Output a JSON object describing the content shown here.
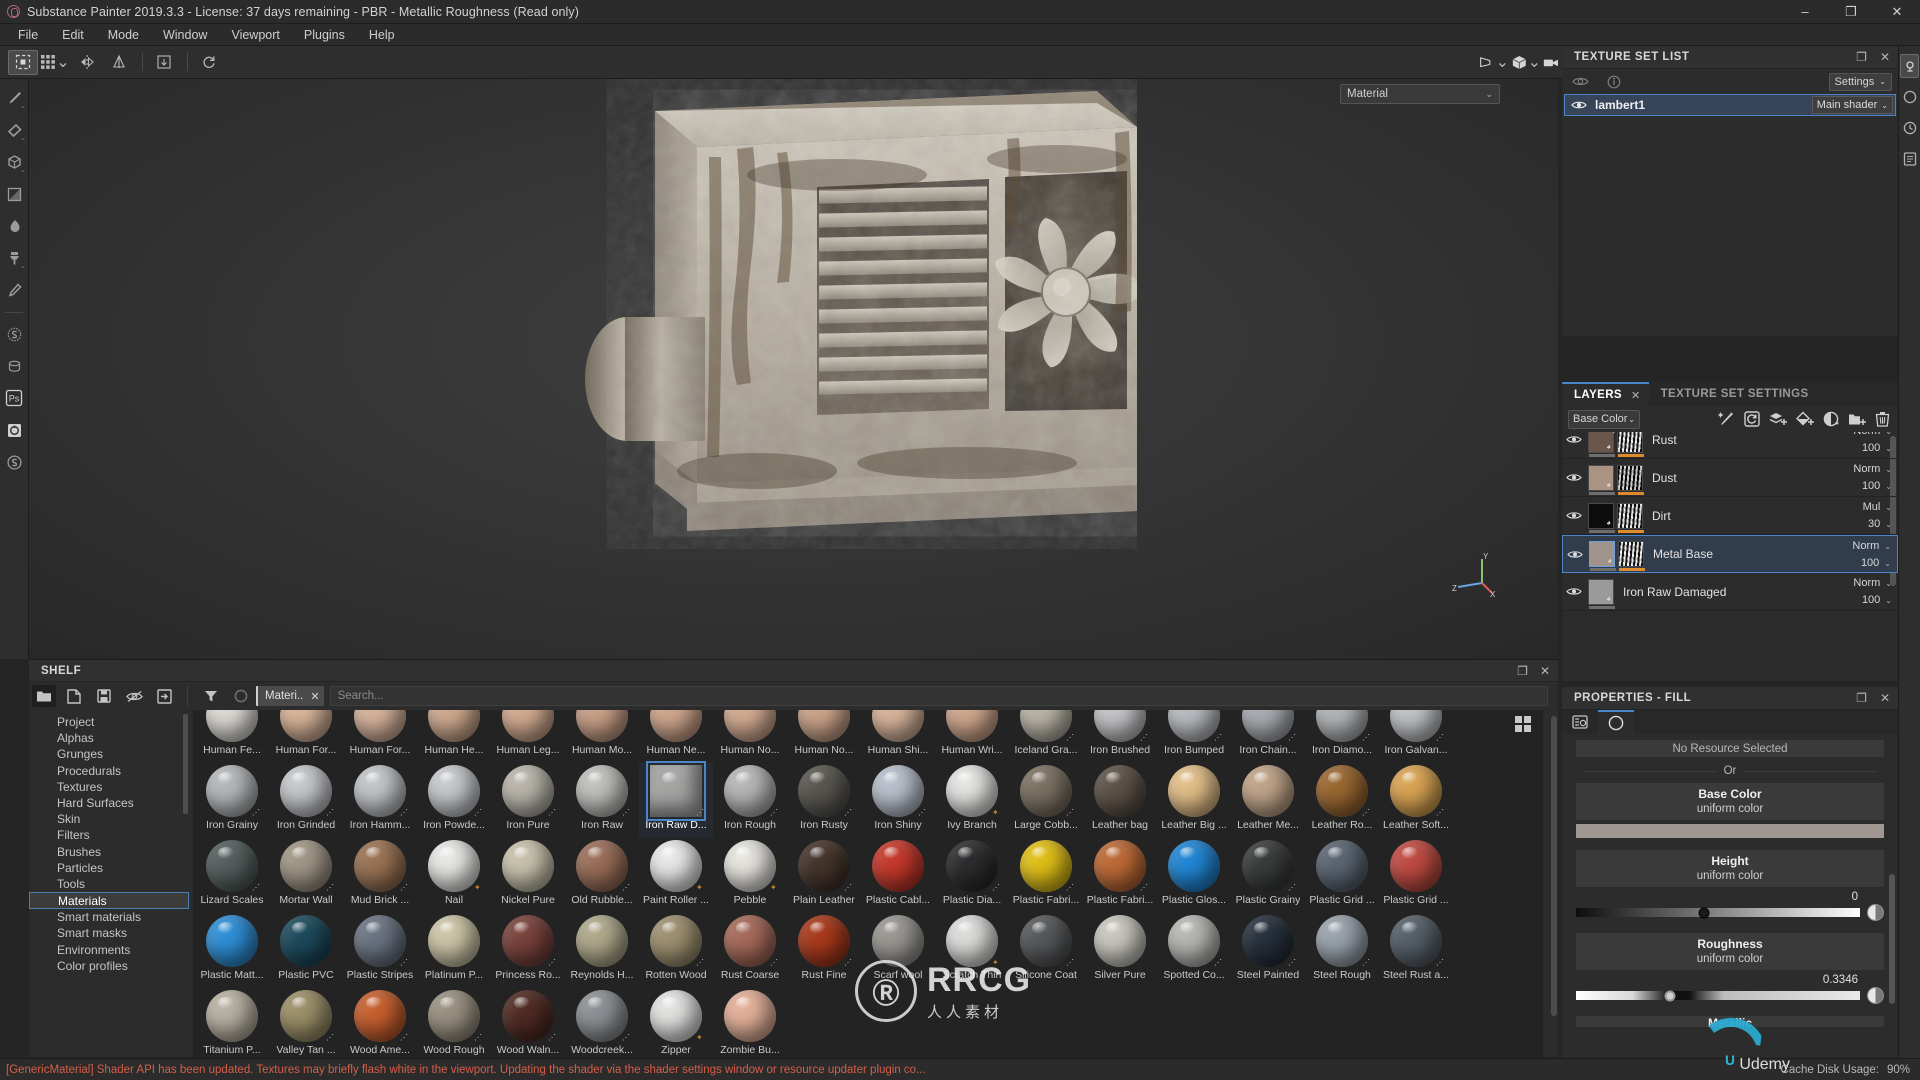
{
  "titlebar": {
    "title": "Substance Painter 2019.3.3 - License: 37 days remaining - PBR - Metallic Roughness (Read only)",
    "minimize": "–",
    "maximize": "❐",
    "close": "✕"
  },
  "menubar": {
    "items": [
      "File",
      "Edit",
      "Mode",
      "Window",
      "Viewport",
      "Plugins",
      "Help"
    ]
  },
  "viewport": {
    "material_selector": "Material",
    "axis": {
      "x": "X",
      "y": "Y",
      "z": "Z"
    }
  },
  "texture_set_list": {
    "title": "TEXTURE SET LIST",
    "settings_label": "Settings",
    "rows": [
      {
        "name": "lambert1",
        "shader": "Main shader"
      }
    ]
  },
  "layers_panel": {
    "tabs": [
      {
        "label": "LAYERS",
        "active": true
      },
      {
        "label": "TEXTURE SET SETTINGS",
        "active": false
      }
    ],
    "channel": "Base Color",
    "layers": [
      {
        "name": "Rust",
        "blend": "Norm",
        "opacity": "100",
        "selected": false,
        "thumb": "#6a564a",
        "mask": "#d8d8d8"
      },
      {
        "name": "Dust",
        "blend": "Norm",
        "opacity": "100",
        "selected": false,
        "thumb": "#ab9383",
        "mask": "#1a1a1a"
      },
      {
        "name": "Dirt",
        "blend": "Mul",
        "opacity": "30",
        "selected": false,
        "thumb": "#0c0c0c",
        "mask": "#b4b4b4"
      },
      {
        "name": "Metal Base",
        "blend": "Norm",
        "opacity": "100",
        "selected": true,
        "thumb": "#a0938b",
        "mask": "#e2e2e2"
      },
      {
        "name": "Iron Raw Damaged",
        "blend": "Norm",
        "opacity": "100",
        "selected": false,
        "thumb": "#9a9a9a",
        "mask": ""
      }
    ]
  },
  "properties_panel": {
    "title": "PROPERTIES - FILL",
    "no_resource": "No Resource Selected",
    "or_label": "Or",
    "blocks": [
      {
        "title": "Base Color",
        "subtitle": "uniform color",
        "type": "color",
        "color": "#a19792"
      },
      {
        "title": "Height",
        "subtitle": "uniform color",
        "type": "slider",
        "value": "0",
        "pos": 45
      },
      {
        "title": "Roughness",
        "subtitle": "uniform color",
        "type": "slider",
        "value": "0.3346",
        "pos": 33
      },
      {
        "title": "Metallic",
        "subtitle": "",
        "type": "partial",
        "value": "",
        "pos": 0
      }
    ]
  },
  "shelf": {
    "title": "SHELF",
    "filter_tag": "Materi..",
    "search_placeholder": "Search...",
    "categories": [
      "Project",
      "Alphas",
      "Grunges",
      "Procedurals",
      "Textures",
      "Hard Surfaces",
      "Skin",
      "Filters",
      "Brushes",
      "Particles",
      "Tools",
      "Materials",
      "Smart materials",
      "Smart masks",
      "Environments",
      "Color profiles"
    ],
    "selected_category": "Materials",
    "materials": [
      {
        "label": "Human Fe...",
        "color": "#dcdad4",
        "badge": ""
      },
      {
        "label": "Human For...",
        "color": "#d8b49a",
        "badge": ""
      },
      {
        "label": "Human For...",
        "color": "#d6b49c",
        "badge": ""
      },
      {
        "label": "Human He...",
        "color": "#cfa98f",
        "badge": ""
      },
      {
        "label": "Human Leg...",
        "color": "#d2ab91",
        "badge": ""
      },
      {
        "label": "Human Mo...",
        "color": "#c9a088",
        "badge": ""
      },
      {
        "label": "Human Ne...",
        "color": "#cfa68d",
        "badge": ""
      },
      {
        "label": "Human No...",
        "color": "#d3ab92",
        "badge": ""
      },
      {
        "label": "Human No...",
        "color": "#cba48b",
        "badge": ""
      },
      {
        "label": "Human Shi...",
        "color": "#d7b49b",
        "badge": ""
      },
      {
        "label": "Human Wri...",
        "color": "#d0a78e",
        "badge": ""
      },
      {
        "label": "Iceland Gra...",
        "color": "#b8b3a6",
        "badge": "dots"
      },
      {
        "label": "Iron Brushed",
        "color": "#c3c4c6",
        "badge": "dots"
      },
      {
        "label": "Iron Bumped",
        "color": "#b9bcc0",
        "badge": "dots"
      },
      {
        "label": "Iron Chain...",
        "color": "#a9adb2",
        "badge": "dots"
      },
      {
        "label": "Iron Diamo...",
        "color": "#b2b5b8",
        "badge": "dots"
      },
      {
        "label": "Iron Galvan...",
        "color": "#c0c3c7",
        "badge": "dots"
      },
      {
        "label": "Iron Grainy",
        "color": "#b5b8bb",
        "badge": "dots"
      },
      {
        "label": "Iron Grinded",
        "color": "#c5c8cc",
        "badge": "dots"
      },
      {
        "label": "Iron Hamm...",
        "color": "#c2c5c9",
        "badge": "dots"
      },
      {
        "label": "Iron Powde...",
        "color": "#c6c9cd",
        "badge": "dots"
      },
      {
        "label": "Iron Pure",
        "color": "#b9b5ab",
        "badge": "dots"
      },
      {
        "label": "Iron Raw",
        "color": "#c0c0bd",
        "badge": "dots"
      },
      {
        "label": "Iron Raw D...",
        "color": "#a5a6a4",
        "badge": "dots",
        "selected": true
      },
      {
        "label": "Iron Rough",
        "color": "#b6b7b6",
        "badge": "dots"
      },
      {
        "label": "Iron Rusty",
        "color": "#595750",
        "badge": "dots"
      },
      {
        "label": "Iron Shiny",
        "color": "#b9c0cc",
        "badge": "dots"
      },
      {
        "label": "Ivy Branch",
        "color": "#e4e4e2",
        "badge": "orange"
      },
      {
        "label": "Large Cobb...",
        "color": "#7c7263",
        "badge": "dots"
      },
      {
        "label": "Leather bag",
        "color": "#5d5248",
        "badge": ""
      },
      {
        "label": "Leather Big ...",
        "color": "#e2bf89",
        "badge": ""
      },
      {
        "label": "Leather Me...",
        "color": "#c0a489",
        "badge": ""
      },
      {
        "label": "Leather Ro...",
        "color": "#9a6730",
        "badge": "dots"
      },
      {
        "label": "Leather Soft...",
        "color": "#d9a453",
        "badge": "dots"
      },
      {
        "label": "Lizard Scales",
        "color": "#555f5e",
        "badge": "dots"
      },
      {
        "label": "Mortar Wall",
        "color": "#a19787",
        "badge": "dots"
      },
      {
        "label": "Mud Brick ...",
        "color": "#9a7354",
        "badge": "dots"
      },
      {
        "label": "Nail",
        "color": "#e7e7e5",
        "badge": "orange"
      },
      {
        "label": "Nickel Pure",
        "color": "#c8c2ac",
        "badge": ""
      },
      {
        "label": "Old Rubble...",
        "color": "#9b6f59",
        "badge": "dots"
      },
      {
        "label": "Paint Roller ...",
        "color": "#e8e8e8",
        "badge": "orange"
      },
      {
        "label": "Pebble",
        "color": "#e6e4de",
        "badge": "orange"
      },
      {
        "label": "Plain Leather",
        "color": "#45352c",
        "badge": "dots"
      },
      {
        "label": "Plastic Cabl...",
        "color": "#c5382c",
        "badge": ""
      },
      {
        "label": "Plastic Dia...",
        "color": "#2c2c2e",
        "badge": "dots"
      },
      {
        "label": "Plastic Fabri...",
        "color": "#e0bf18",
        "badge": "dots"
      },
      {
        "label": "Plastic Fabri...",
        "color": "#bd6a36",
        "badge": "dots"
      },
      {
        "label": "Plastic Glos...",
        "color": "#2186d4",
        "badge": ""
      },
      {
        "label": "Plastic Grainy",
        "color": "#3a3c3c",
        "badge": "dots"
      },
      {
        "label": "Plastic Grid ...",
        "color": "#5b6572",
        "badge": ""
      },
      {
        "label": "Plastic Grid ...",
        "color": "#c04b42",
        "badge": ""
      },
      {
        "label": "Plastic Matt...",
        "color": "#2e8ed6",
        "badge": ""
      },
      {
        "label": "Plastic PVC",
        "color": "#1c4a5c",
        "badge": ""
      },
      {
        "label": "Plastic Stripes",
        "color": "#6b7483",
        "badge": "dots"
      },
      {
        "label": "Platinum P...",
        "color": "#cdc5a8",
        "badge": ""
      },
      {
        "label": "Princess Ro...",
        "color": "#79423c",
        "badge": "dots"
      },
      {
        "label": "Reynolds H...",
        "color": "#b0a98c",
        "badge": ""
      },
      {
        "label": "Rotten Wood",
        "color": "#9e9170",
        "badge": "dots"
      },
      {
        "label": "Rust Coarse",
        "color": "#a66a5a",
        "badge": "dots"
      },
      {
        "label": "Rust Fine",
        "color": "#a8391c",
        "badge": "dots"
      },
      {
        "label": "Scarf wool",
        "color": "#9a9792",
        "badge": ""
      },
      {
        "label": "Scratch Thin",
        "color": "#dcdcda",
        "badge": "orange"
      },
      {
        "label": "Silicone Coat",
        "color": "#56585a",
        "badge": "dots"
      },
      {
        "label": "Silver Pure",
        "color": "#c8c6be",
        "badge": ""
      },
      {
        "label": "Spotted Co...",
        "color": "#b7b8b4",
        "badge": "dots"
      },
      {
        "label": "Steel Painted",
        "color": "#27303c",
        "badge": "dots"
      },
      {
        "label": "Steel Rough",
        "color": "#9aa3ad",
        "badge": "dots"
      },
      {
        "label": "Steel Rust a...",
        "color": "#566069",
        "badge": "dots"
      },
      {
        "label": "Titanium P...",
        "color": "#b9b2a3",
        "badge": ""
      },
      {
        "label": "Valley Tan ...",
        "color": "#9c9069",
        "badge": "dots"
      },
      {
        "label": "Wood Ame...",
        "color": "#c75f2e",
        "badge": "dots"
      },
      {
        "label": "Wood Rough",
        "color": "#9a9181",
        "badge": "dots"
      },
      {
        "label": "Wood Waln...",
        "color": "#4f2b22",
        "badge": "dots"
      },
      {
        "label": "Woodcreek...",
        "color": "#8d9195",
        "badge": "dots"
      },
      {
        "label": "Zipper",
        "color": "#e2e3e1",
        "badge": "orange"
      },
      {
        "label": "Zombie Bu...",
        "color": "#e4b09a",
        "badge": ""
      }
    ]
  },
  "watermark": {
    "logo": "Ⓡ",
    "main": "RRCG",
    "sub": "人人素材"
  },
  "statusbar": {
    "message": "[GenericMaterial] Shader API has been updated. Textures may briefly flash white in the viewport. Updating the shader via the shader settings window or resource updater plugin co...",
    "cache_label": "Cache Disk Usage:",
    "cache_value": "90%",
    "brand": "Udemy"
  }
}
